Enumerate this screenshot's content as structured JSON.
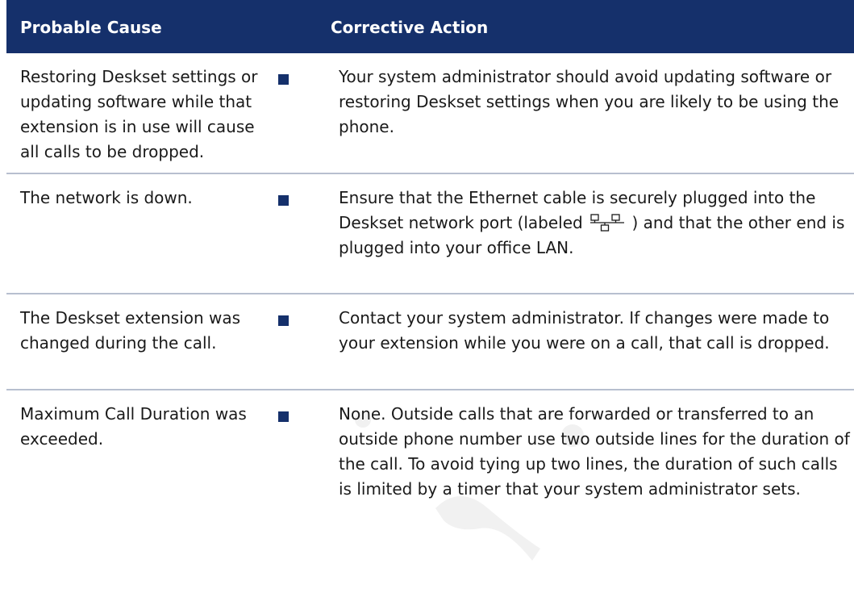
{
  "table": {
    "headers": {
      "cause": "Probable Cause",
      "action": "Corrective Action"
    },
    "rows": [
      {
        "cause": "Restoring Deskset settings or updating software while that extension is in use will cause all calls to be dropped.",
        "action": "Your system administrator should avoid updating software or restoring Deskset settings when you are likely to be using the phone."
      },
      {
        "cause": "The network is down.",
        "action_before_icon": "Ensure that the Ethernet cable is securely plugged into the Deskset network port (labeled",
        "action_icon": "network-port-icon",
        "action_after_icon": ") and that the other end is plugged into your office LAN."
      },
      {
        "cause": "The Deskset extension was changed during the call.",
        "action": "Contact your system administrator. If changes were made to your extension while you were on a call, that call is dropped."
      },
      {
        "cause": "Maximum Call Duration was exceeded.",
        "action": "None. Outside calls that are forwarded or transferred to an outside phone number use two outside lines for the duration of the call. To avoid tying up two lines, the duration of such calls is limited by a timer that your system administrator sets."
      }
    ]
  },
  "colors": {
    "header_bg": "#15306b",
    "header_text": "#ffffff",
    "bullet": "#15306b",
    "row_divider": "#b7bfcf"
  }
}
